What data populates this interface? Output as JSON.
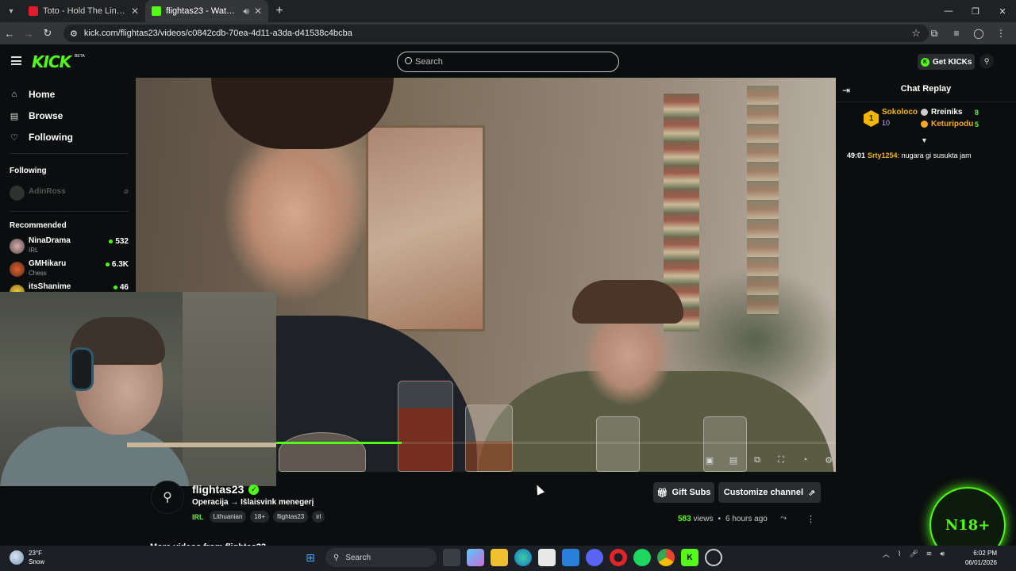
{
  "browser": {
    "tabs": [
      {
        "title": "Toto - Hold The Line (GTA SA) |",
        "favicon_color": "#e21b2c",
        "active": false
      },
      {
        "title": "flightas23 - Watch the VOD",
        "favicon_color": "#53fc18",
        "active": true
      }
    ],
    "url": "kick.com/flightas23/videos/c0842cdb-70ea-4d11-a3da-d41538c4bcba"
  },
  "header": {
    "logo": "KICK",
    "logo_badge": "BETA",
    "search_placeholder": "Search",
    "get_kicks_label": "Get KICKs"
  },
  "sidebar": {
    "nav": [
      {
        "label": "Home",
        "icon": "home-icon"
      },
      {
        "label": "Browse",
        "icon": "browse-icon"
      },
      {
        "label": "Following",
        "icon": "heart-icon"
      }
    ],
    "following_header": "Following",
    "following": [
      {
        "name": "AdinRoss"
      }
    ],
    "recommended_header": "Recommended",
    "recommended": [
      {
        "name": "NinaDrama",
        "category": "IRL",
        "viewers": "532"
      },
      {
        "name": "GMHikaru",
        "category": "Chess",
        "viewers": "6.3K"
      },
      {
        "name": "itsShanime",
        "category": "",
        "viewers": "46"
      }
    ]
  },
  "video": {
    "progress": 0.38
  },
  "channel": {
    "name": "flightas23",
    "title": "Operacija → Išlaisvink menegerį",
    "category": "IRL",
    "tags": [
      "Lithuanian",
      "18+",
      "flightas23",
      "irl"
    ],
    "gift_subs_label": "Gift Subs",
    "customize_label": "Customize channel",
    "views_count": "583",
    "views_label": "views",
    "posted": "6 hours ago",
    "more_videos": "More videos from flightas23"
  },
  "chat": {
    "title": "Chat Replay",
    "top_gifter": {
      "rank": "1",
      "name": "Sokoloco",
      "count": "10"
    },
    "gifters": [
      {
        "name": "Rreiniks",
        "count": "8",
        "color": "#ffffff"
      },
      {
        "name": "Keturipodu",
        "count": "5",
        "color": "#f5a623"
      }
    ],
    "messages": [
      {
        "time": "49:01",
        "user": "Srty1254",
        "text": "nugara gi susukta jam"
      }
    ]
  },
  "badge": {
    "text": "N18+"
  },
  "taskbar": {
    "weather_temp": "23°F",
    "weather_desc": "Snow",
    "search_label": "Search",
    "time": "6:02 PM",
    "date": "06/01/2026"
  }
}
